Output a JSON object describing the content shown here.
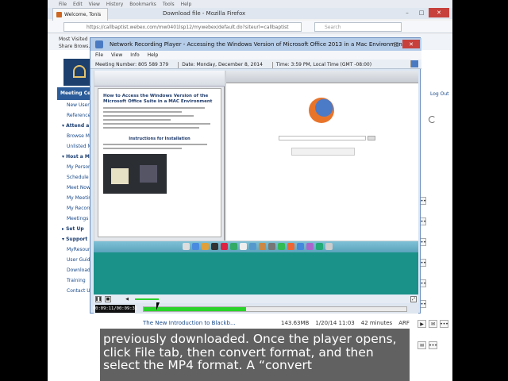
{
  "browser": {
    "menu": [
      "File",
      "Edit",
      "View",
      "History",
      "Bookmarks",
      "Tools",
      "Help"
    ],
    "tab_title": "Welcome, Tonis",
    "window_title": "Download file - Mozilla Firefox",
    "url": "https://callbapti...",
    "address": "https://callbaptist.webex.com/mw0401lsp12/mywebex/default.do?siteurl=callbaptist",
    "search_placeholder": "Search",
    "bookmarks": [
      "Most Visited",
      "Share Brows..."
    ],
    "logout": "Log Out"
  },
  "sidebar": {
    "header": "Meeting Cent",
    "items": [
      {
        "label": "New User",
        "type": "i"
      },
      {
        "label": "Reference",
        "type": "i"
      },
      {
        "label": "▾ Attend a",
        "type": "s"
      },
      {
        "label": "Browse M",
        "type": "i"
      },
      {
        "label": "Unlisted M",
        "type": "i"
      },
      {
        "label": "▾ Host a Me",
        "type": "s"
      },
      {
        "label": "My Person",
        "type": "i"
      },
      {
        "label": "Schedule",
        "type": "i"
      },
      {
        "label": "Meet Now",
        "type": "i"
      },
      {
        "label": "My Meetin",
        "type": "i"
      },
      {
        "label": "My Record",
        "type": "i"
      },
      {
        "label": "Meetings",
        "type": "i"
      },
      {
        "label": "▸ Set Up",
        "type": "s"
      },
      {
        "label": "▾ Support",
        "type": "s"
      },
      {
        "label": "MyResour",
        "type": "i"
      },
      {
        "label": "User Guid",
        "type": "i"
      },
      {
        "label": "Download",
        "type": "i"
      },
      {
        "label": "Training",
        "type": "i"
      },
      {
        "label": "Contact U",
        "type": "i"
      }
    ]
  },
  "player": {
    "title": "Network Recording Player - Accessing the Windows Version of Microsoft Office 2013 in a Mac Environment",
    "menu": [
      "File",
      "View",
      "Info",
      "Help"
    ],
    "meeting_number": "Meeting Number: 805 589 379",
    "date": "Date: Monday, December 8, 2014",
    "time": "Time: 3:59 PM, Local Time (GMT -08:00)",
    "time_display": "00:09:11/00:09:31",
    "progress_fraction": 0.39,
    "doc_heading": "How to Access the Windows Version of the Microsoft Office Suite in a MAC Environment",
    "doc_subheading": "Instructions for Installation"
  },
  "recording_row": {
    "name": "The New Introduction to Blackb...",
    "size": "143.63MB",
    "date": "1/20/14 11:03",
    "duration": "42 minutes",
    "format": "ARF"
  },
  "caption": {
    "lines": [
      "previously downloaded. Once the player opens,",
      "click File tab, then convert format, and then",
      "select the MP4 format. A “convert"
    ]
  },
  "colors": {
    "player_title_bg": "#b6cde9",
    "progress_fill": "#29d329",
    "video_bg": "#1a9189",
    "close_red": "#c7403b"
  }
}
